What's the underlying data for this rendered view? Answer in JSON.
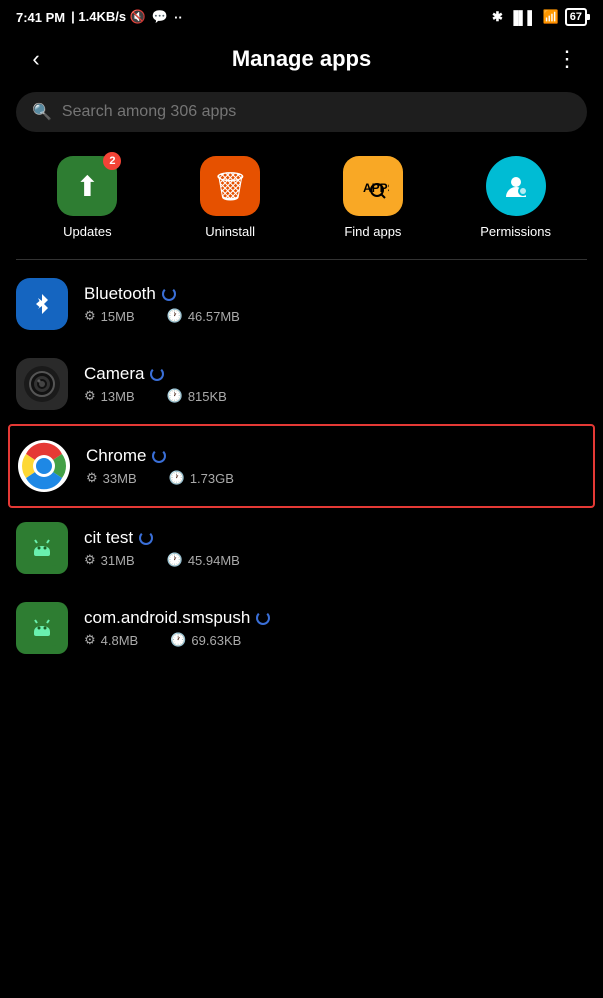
{
  "statusBar": {
    "time": "7:41 PM",
    "network": "1.4KB/s",
    "battery": "67"
  },
  "header": {
    "title": "Manage apps",
    "backLabel": "‹",
    "moreLabel": "⋮"
  },
  "search": {
    "placeholder": "Search among 306 apps"
  },
  "quickActions": [
    {
      "id": "updates",
      "label": "Updates",
      "icon": "⬆",
      "color": "green",
      "badge": "2"
    },
    {
      "id": "uninstall",
      "label": "Uninstall",
      "icon": "🗑",
      "color": "orange",
      "badge": ""
    },
    {
      "id": "find-apps",
      "label": "Find apps",
      "icon": "🔍",
      "color": "yellow",
      "badge": ""
    },
    {
      "id": "permissions",
      "label": "Permissions",
      "icon": "👤",
      "color": "cyan",
      "badge": ""
    }
  ],
  "apps": [
    {
      "id": "bluetooth",
      "name": "Bluetooth",
      "iconType": "bluetooth",
      "size": "15MB",
      "cache": "46.57MB",
      "highlighted": false
    },
    {
      "id": "camera",
      "name": "Camera",
      "iconType": "camera",
      "size": "13MB",
      "cache": "815KB",
      "highlighted": false
    },
    {
      "id": "chrome",
      "name": "Chrome",
      "iconType": "chrome",
      "size": "33MB",
      "cache": "1.73GB",
      "highlighted": true
    },
    {
      "id": "cit-test",
      "name": "cit test",
      "iconType": "android",
      "size": "31MB",
      "cache": "45.94MB",
      "highlighted": false
    },
    {
      "id": "com-android-smspush",
      "name": "com.android.smspush",
      "iconType": "android",
      "size": "4.8MB",
      "cache": "69.63KB",
      "highlighted": false
    }
  ],
  "icons": {
    "storage": "⚙",
    "clock": "🕐"
  }
}
